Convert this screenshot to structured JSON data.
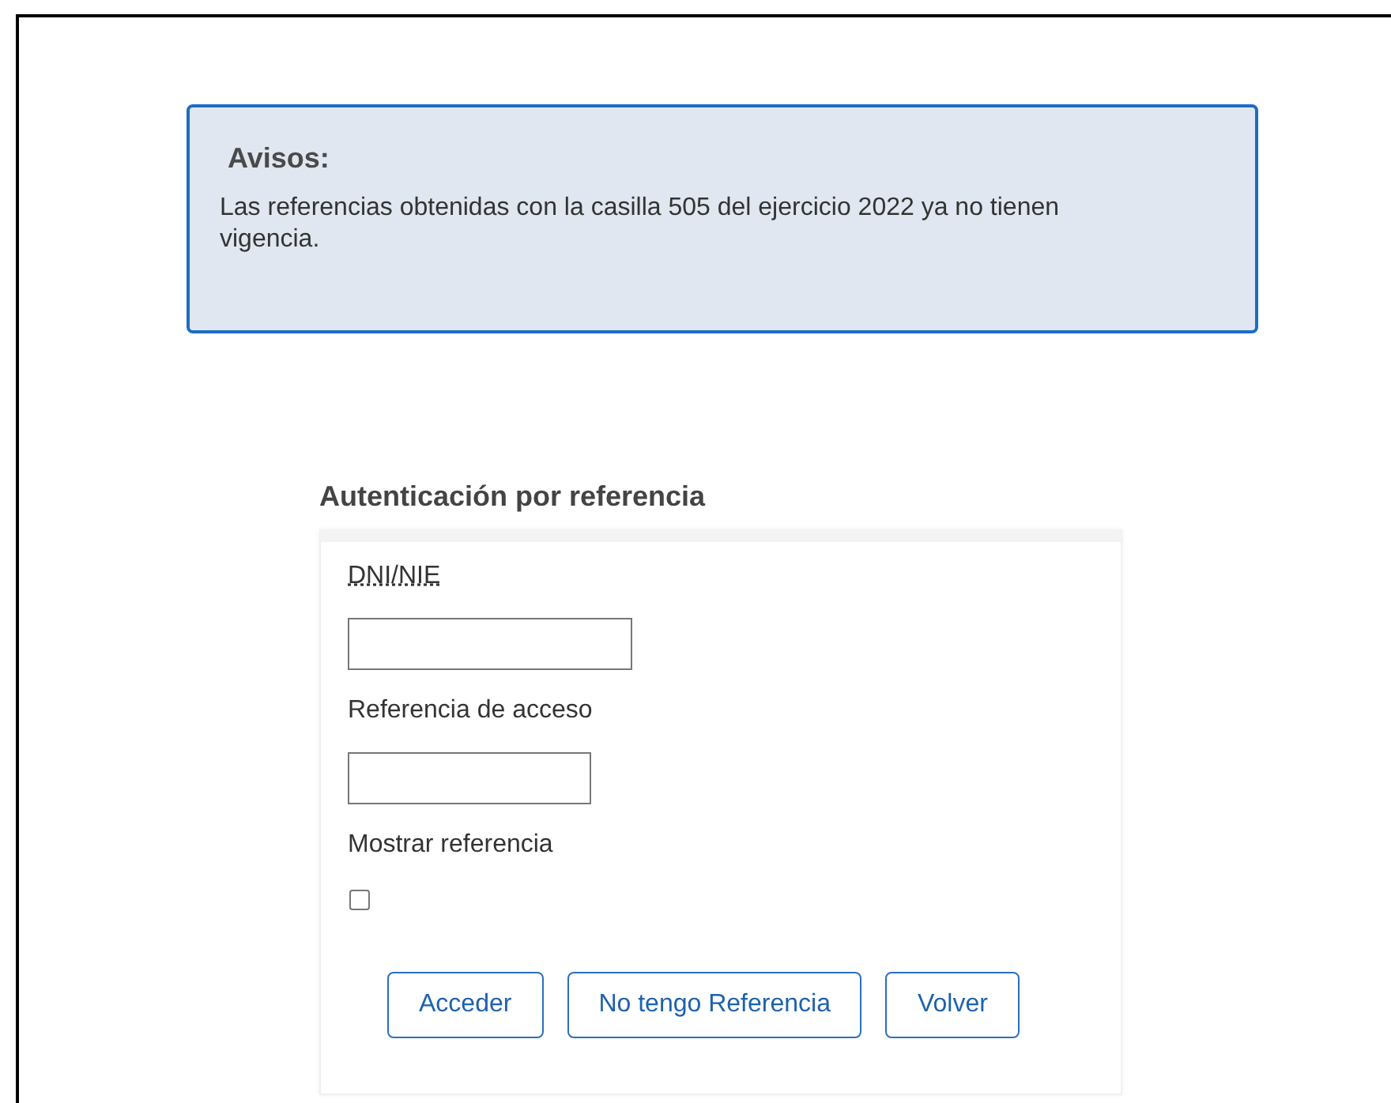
{
  "notice": {
    "title": "Avisos:",
    "text": "Las referencias obtenidas con la casilla 505 del ejercicio 2022 ya no tienen vigencia."
  },
  "form": {
    "title": "Autenticación por referencia",
    "fields": [
      {
        "kind": "text",
        "label": "DNI/NIE",
        "abbreviation": true
      },
      {
        "kind": "text",
        "label": "Referencia de acceso",
        "abbreviation": false
      },
      {
        "kind": "checkbox",
        "label": "Mostrar referencia",
        "abbreviation": false,
        "checked": false
      }
    ],
    "buttons": [
      "Acceder",
      "No tengo Referencia",
      "Volver"
    ]
  }
}
